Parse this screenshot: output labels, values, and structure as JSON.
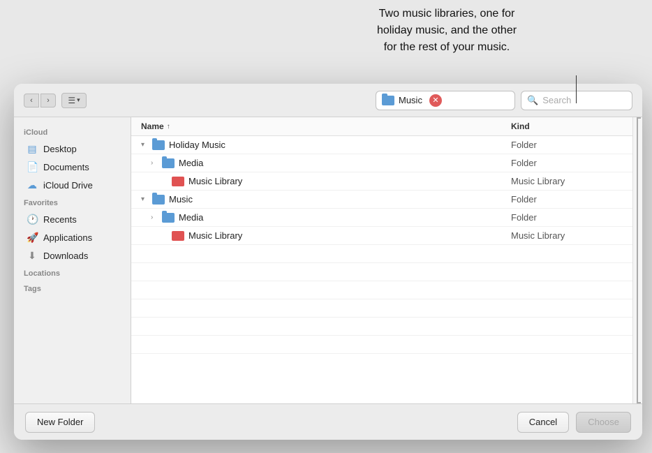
{
  "tooltip": {
    "line1": "Two music libraries, one for",
    "line2": "holiday music, and the other",
    "line3": "for the rest of your music."
  },
  "toolbar": {
    "location_name": "Music",
    "search_placeholder": "Search"
  },
  "sidebar": {
    "icloud_label": "iCloud",
    "desktop_label": "Desktop",
    "documents_label": "Documents",
    "icloud_drive_label": "iCloud Drive",
    "favorites_label": "Favorites",
    "recents_label": "Recents",
    "applications_label": "Applications",
    "downloads_label": "Downloads",
    "locations_label": "Locations",
    "tags_label": "Tags"
  },
  "file_list": {
    "col_name": "Name",
    "col_kind": "Kind",
    "rows": [
      {
        "indent": 1,
        "chevron": "down",
        "icon": "folder",
        "name": "Holiday Music",
        "kind": "Folder"
      },
      {
        "indent": 2,
        "chevron": "right",
        "icon": "folder",
        "name": "Media",
        "kind": "Folder"
      },
      {
        "indent": 3,
        "chevron": "",
        "icon": "music-lib",
        "name": "Music Library",
        "kind": "Music Library"
      },
      {
        "indent": 1,
        "chevron": "down",
        "icon": "folder",
        "name": "Music",
        "kind": "Folder"
      },
      {
        "indent": 2,
        "chevron": "right",
        "icon": "folder",
        "name": "Media",
        "kind": "Folder"
      },
      {
        "indent": 3,
        "chevron": "",
        "icon": "music-lib",
        "name": "Music Library",
        "kind": "Music Library"
      }
    ]
  },
  "buttons": {
    "new_folder": "New Folder",
    "cancel": "Cancel",
    "choose": "Choose"
  }
}
